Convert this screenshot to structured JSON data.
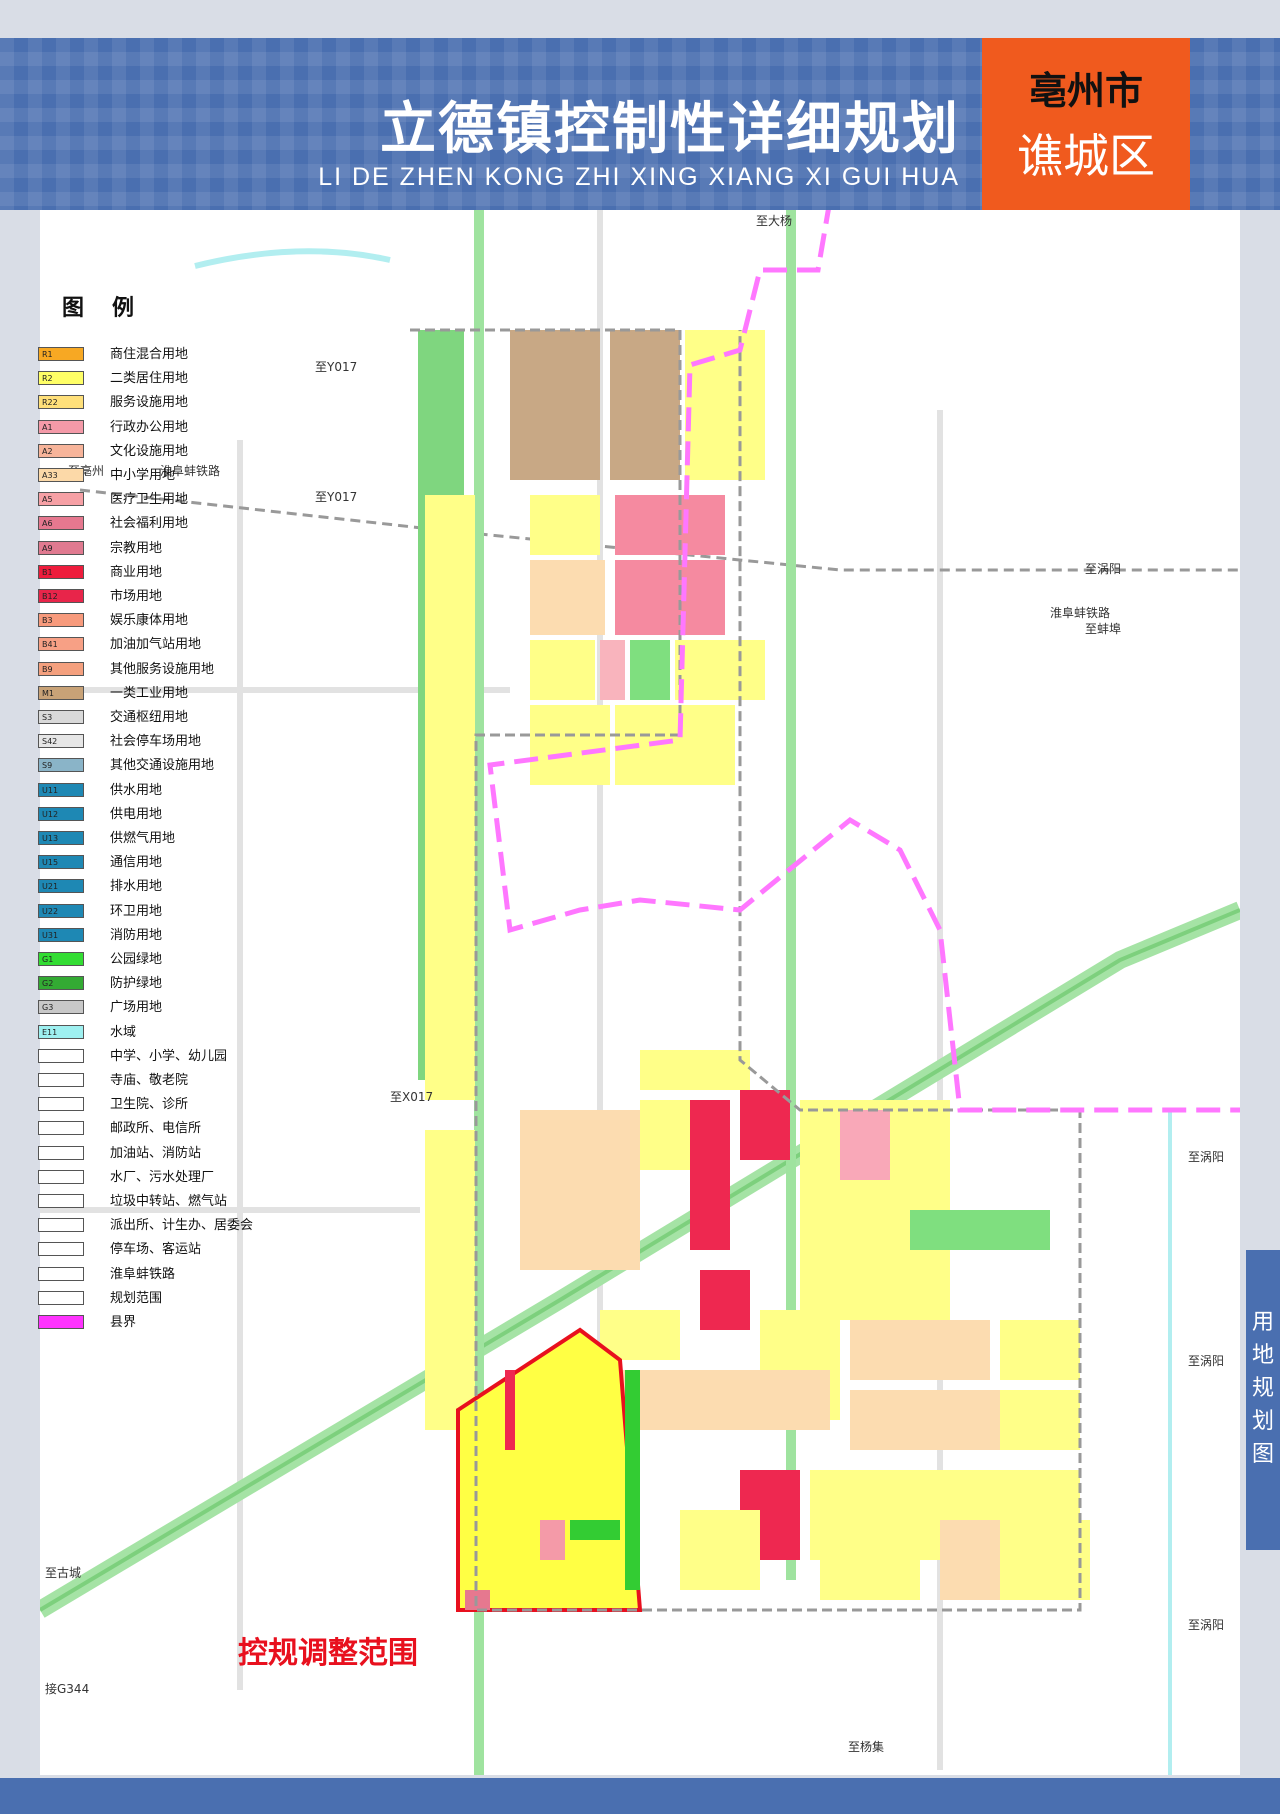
{
  "header": {
    "title_cn": "立德镇控制性详细规划",
    "title_en": "LI DE ZHEN  KONG ZHI XING XIANG XI GUI HUA",
    "badge_city": "亳州市",
    "badge_district": "谯城区",
    "colors": {
      "header_bg": "#4a6fb0",
      "badge_bg": "#f05a1e"
    }
  },
  "side_tab": {
    "text": "用地规划图"
  },
  "legend": {
    "title": "图例",
    "items": [
      {
        "code": "R1",
        "label": "商住混合用地",
        "color": "#f7a823"
      },
      {
        "code": "R2",
        "label": "二类居住用地",
        "color": "#ffff66"
      },
      {
        "code": "R22",
        "label": "服务设施用地",
        "color": "#ffe07a"
      },
      {
        "code": "A1",
        "label": "行政办公用地",
        "color": "#f49aa8"
      },
      {
        "code": "A2",
        "label": "文化设施用地",
        "color": "#f7b49a"
      },
      {
        "code": "A33",
        "label": "中小学用地",
        "color": "#fcd9a8"
      },
      {
        "code": "A5",
        "label": "医疗卫生用地",
        "color": "#f6a0a5"
      },
      {
        "code": "A6",
        "label": "社会福利用地",
        "color": "#e6788f"
      },
      {
        "code": "A9",
        "label": "宗教用地",
        "color": "#e07a90"
      },
      {
        "code": "B1",
        "label": "商业用地",
        "color": "#ee1c3c"
      },
      {
        "code": "B12",
        "label": "市场用地",
        "color": "#e8254a"
      },
      {
        "code": "B3",
        "label": "娱乐康体用地",
        "color": "#f79a7c"
      },
      {
        "code": "B41",
        "label": "加油加气站用地",
        "color": "#f7a085"
      },
      {
        "code": "B9",
        "label": "其他服务设施用地",
        "color": "#f4a07e"
      },
      {
        "code": "M1",
        "label": "一类工业用地",
        "color": "#c8a277"
      },
      {
        "code": "S3",
        "label": "交通枢纽用地",
        "color": "#d9d9d9"
      },
      {
        "code": "S42",
        "label": "社会停车场用地",
        "color": "#e6e6e6"
      },
      {
        "code": "S9",
        "label": "其他交通设施用地",
        "color": "#8ab4c8"
      },
      {
        "code": "U11",
        "label": "供水用地",
        "color": "#1e88b4"
      },
      {
        "code": "U12",
        "label": "供电用地",
        "color": "#1e88b4"
      },
      {
        "code": "U13",
        "label": "供燃气用地",
        "color": "#1e88b4"
      },
      {
        "code": "U15",
        "label": "通信用地",
        "color": "#1e88b4"
      },
      {
        "code": "U21",
        "label": "排水用地",
        "color": "#1e88b4"
      },
      {
        "code": "U22",
        "label": "环卫用地",
        "color": "#1e88b4"
      },
      {
        "code": "U31",
        "label": "消防用地",
        "color": "#1e88b4"
      },
      {
        "code": "G1",
        "label": "公园绿地",
        "color": "#33dd33"
      },
      {
        "code": "G2",
        "label": "防护绿地",
        "color": "#33aa33"
      },
      {
        "code": "G3",
        "label": "广场用地",
        "color": "#c8c8c8"
      },
      {
        "code": "E11",
        "label": "水域",
        "color": "#9ef0f0"
      },
      {
        "code": "",
        "label": "中学、小学、幼儿园",
        "color": "#ffffff"
      },
      {
        "code": "",
        "label": "寺庙、敬老院",
        "color": "#ffffff"
      },
      {
        "code": "",
        "label": "卫生院、诊所",
        "color": "#ffffff"
      },
      {
        "code": "",
        "label": "邮政所、电信所",
        "color": "#ffffff"
      },
      {
        "code": "",
        "label": "加油站、消防站",
        "color": "#ffffff"
      },
      {
        "code": "",
        "label": "水厂、污水处理厂",
        "color": "#ffffff"
      },
      {
        "code": "",
        "label": "垃圾中转站、燃气站",
        "color": "#ffffff"
      },
      {
        "code": "",
        "label": "派出所、计生办、居委会",
        "color": "#ffffff"
      },
      {
        "code": "",
        "label": "停车场、客运站",
        "color": "#ffffff"
      },
      {
        "code": "",
        "label": "淮阜蚌铁路",
        "color": "#ffffff"
      },
      {
        "code": "",
        "label": "规划范围",
        "color": "#ffffff"
      },
      {
        "code": "",
        "label": "县界",
        "color": "#ff33ff"
      }
    ]
  },
  "places": [
    {
      "text": "至大杨"
    },
    {
      "text": "至Y017"
    },
    {
      "text": "至亳州"
    },
    {
      "text": "淮阜蚌铁路"
    },
    {
      "text": "至Y017"
    },
    {
      "text": "至涡阳"
    },
    {
      "text": "淮阜蚌铁路"
    },
    {
      "text": "至蚌埠"
    },
    {
      "text": "至X017"
    },
    {
      "text": "至涡阳"
    },
    {
      "text": "至涡阳"
    },
    {
      "text": "至涡阳"
    },
    {
      "text": "至古城"
    },
    {
      "text": "接G344"
    },
    {
      "text": "至杨集"
    }
  ],
  "adjust_label": "控规调整范围"
}
